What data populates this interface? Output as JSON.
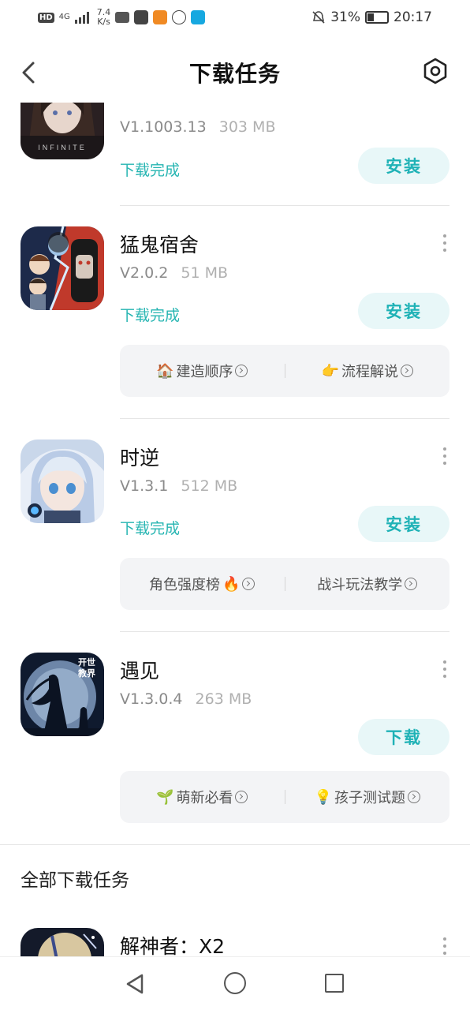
{
  "status_bar": {
    "network_badge": "HD",
    "signal_label": "4G",
    "speed_value": "7.4",
    "speed_unit": "K/s",
    "battery": "31%",
    "time": "20:17"
  },
  "header": {
    "title": "下载任务",
    "back_icon": "back-arrow-icon",
    "settings_icon": "hexagon-settings-icon"
  },
  "items": [
    {
      "name": "",
      "version": "V1.1003.13",
      "size": "303 MB",
      "status": "下载完成",
      "action": "安装",
      "icon_caption": "INFINITE",
      "icon_colors": [
        "#2a2022",
        "#6b4a3f",
        "#d8c4b8"
      ]
    },
    {
      "name": "猛鬼宿舍",
      "version": "V2.0.2",
      "size": "51 MB",
      "status": "下载完成",
      "action": "安装",
      "icon_colors": [
        "#1d2a4a",
        "#c0392b",
        "#e8d8c8"
      ],
      "guides": [
        {
          "emoji": "🏠",
          "label": "建造顺序"
        },
        {
          "emoji": "👉",
          "label": "流程解说"
        }
      ]
    },
    {
      "name": "时逆",
      "version": "V1.3.1",
      "size": "512 MB",
      "status": "下载完成",
      "action": "安装",
      "icon_colors": [
        "#e8eef7",
        "#8fb2dd",
        "#3a4a6a"
      ],
      "guides": [
        {
          "emoji": "🔥",
          "label": "角色强度榜",
          "emoji_after": true
        },
        {
          "emoji": "",
          "label": "战斗玩法教学"
        }
      ]
    },
    {
      "name": "遇见",
      "version": "V1.3.0.4",
      "size": "263 MB",
      "status": "",
      "action": "下载",
      "icon_caption_a": "开世",
      "icon_caption_b": "教界",
      "icon_colors": [
        "#0f1a2e",
        "#6d86a8",
        "#e6eef5"
      ],
      "guides": [
        {
          "emoji": "🌱",
          "label": "萌新必看"
        },
        {
          "emoji": "💡",
          "label": "孩子测试题"
        }
      ]
    }
  ],
  "section": {
    "title": "全部下载任务"
  },
  "bottom_item": {
    "name": "解神者：X2"
  }
}
